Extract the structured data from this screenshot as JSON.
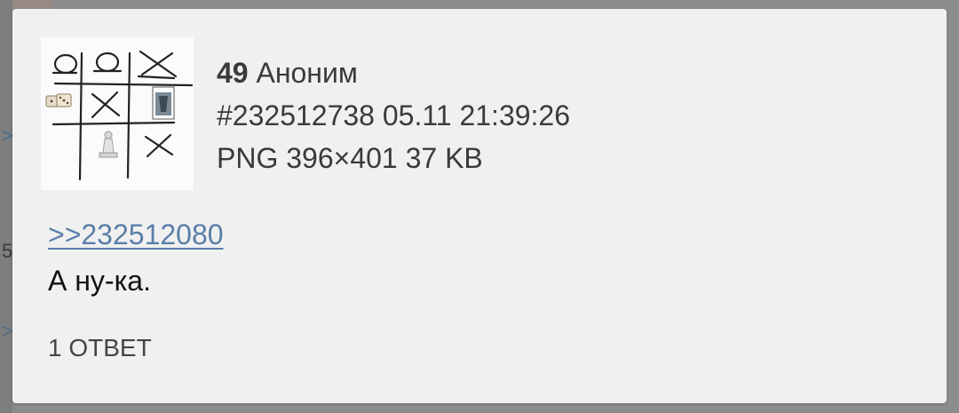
{
  "post": {
    "number": "49",
    "author": "Аноним",
    "id": "#232512738",
    "date": "05.11",
    "time": "21:39:26",
    "file": {
      "format": "PNG",
      "dimensions": "396×401",
      "size": "37 KB"
    },
    "reply_link": ">>232512080",
    "comment": "А ну-ка.",
    "replies_label": "1 ОТВЕТ"
  },
  "colors": {
    "card_bg": "#f0f0f0",
    "overlay": "#8c8c8c",
    "link": "#5a7fa8"
  },
  "icons": [
    "tictactoe-thumbnail",
    "dice-icon",
    "playing-card-icon",
    "chess-pawn-icon"
  ]
}
